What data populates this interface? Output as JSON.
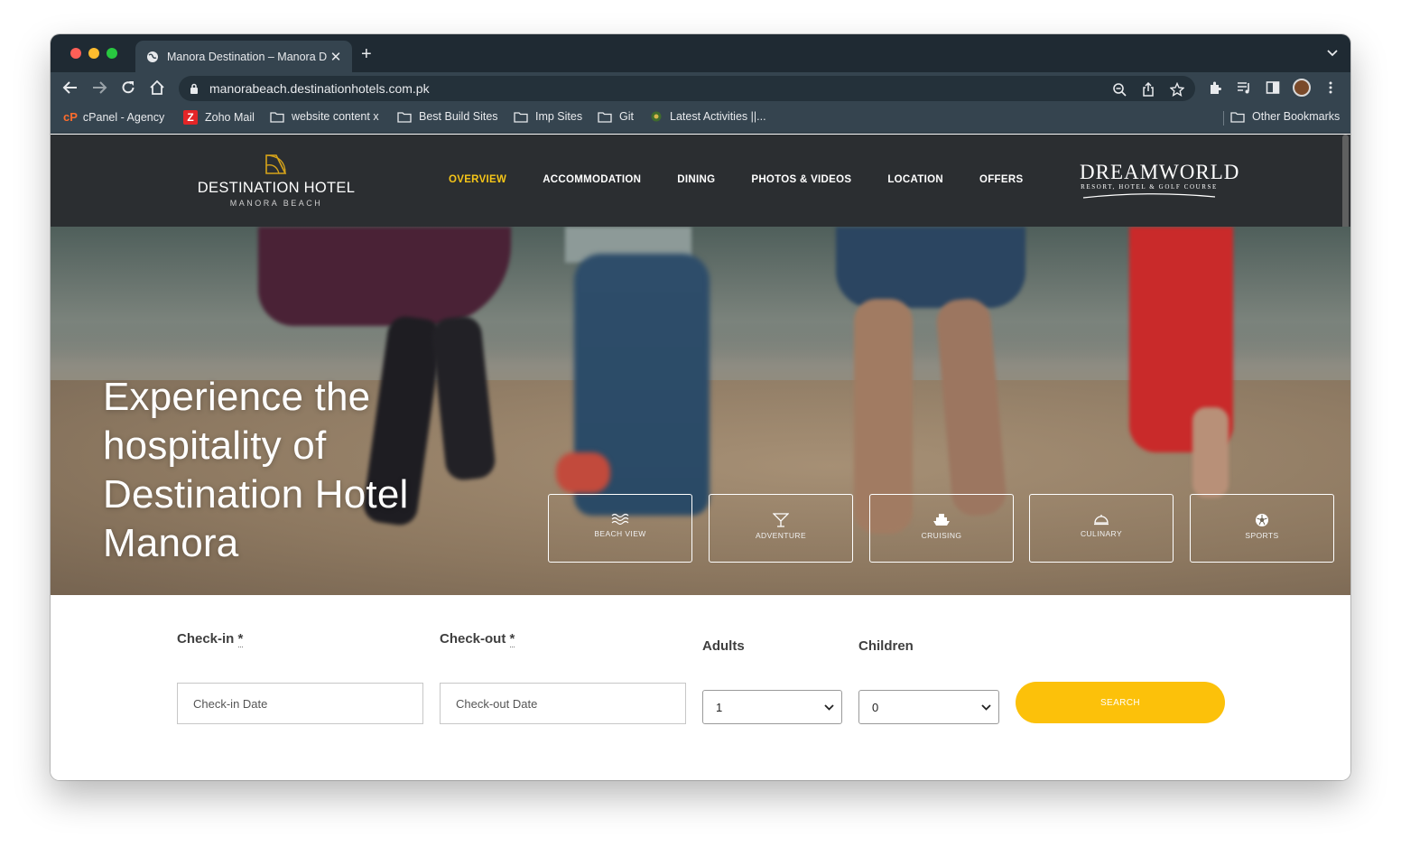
{
  "browser": {
    "tab_title": "Manora Destination – Manora D",
    "url": "manorabeach.destinationhotels.com.pk",
    "bookmarks": [
      {
        "label": "cPanel - Agency",
        "icon": "cpanel-icon"
      },
      {
        "label": "Zoho Mail",
        "icon": "zoho-icon"
      },
      {
        "label": "website content x",
        "icon": "folder-icon"
      },
      {
        "label": "Best Build Sites",
        "icon": "folder-icon"
      },
      {
        "label": "Imp Sites",
        "icon": "folder-icon"
      },
      {
        "label": "Git",
        "icon": "folder-icon"
      },
      {
        "label": "Latest Activities ||...",
        "icon": "site-icon"
      }
    ],
    "other_bookmarks": "Other Bookmarks"
  },
  "site": {
    "logo_name": "DESTINATION HOTEL",
    "logo_sub": "MANORA BEACH",
    "nav": [
      "OVERVIEW",
      "ACCOMMODATION",
      "DINING",
      "PHOTOS & VIDEOS",
      "LOCATION",
      "OFFERS"
    ],
    "active_nav": "OVERVIEW",
    "partner_name": "DREAMWORLD",
    "partner_sub": "RESORT, HOTEL & GOLF COURSE",
    "accent_color": "#f5c518"
  },
  "hero": {
    "title": "Experience the hospitality of Destination Hotel Manora",
    "features": [
      {
        "label": "BEACH VIEW",
        "icon": "waves-icon"
      },
      {
        "label": "ADVENTURE",
        "icon": "cocktail-icon"
      },
      {
        "label": "CRUISING",
        "icon": "ship-icon"
      },
      {
        "label": "CULINARY",
        "icon": "cloche-icon"
      },
      {
        "label": "SPORTS",
        "icon": "football-icon"
      }
    ]
  },
  "booking": {
    "checkin_label": "Check-in",
    "checkout_label": "Check-out",
    "required_mark": "*",
    "adults_label": "Adults",
    "children_label": "Children",
    "checkin_placeholder": "Check-in Date",
    "checkout_placeholder": "Check-out Date",
    "adults_value": "1",
    "children_value": "0",
    "search_label": "SEARCH",
    "button_color": "#fcc10a"
  }
}
